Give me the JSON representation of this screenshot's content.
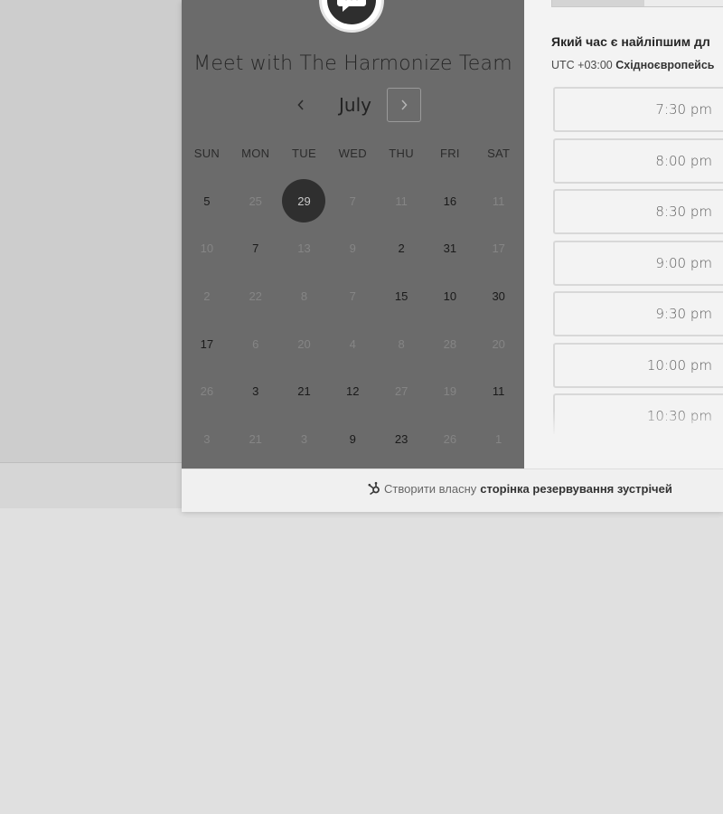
{
  "scheduler": {
    "title": "Meet with The Harmonize Team",
    "month": "July",
    "weekdays": [
      "SUN",
      "MON",
      "TUE",
      "WED",
      "THU",
      "FRI",
      "SAT"
    ],
    "weeks": [
      [
        {
          "d": "5",
          "s": "avail"
        },
        {
          "d": "25",
          "s": "dim"
        },
        {
          "d": "29",
          "s": "sel"
        },
        {
          "d": "7",
          "s": "dim"
        },
        {
          "d": "11",
          "s": "dim"
        },
        {
          "d": "16",
          "s": "avail"
        },
        {
          "d": "11",
          "s": "dim"
        }
      ],
      [
        {
          "d": "10",
          "s": "dim"
        },
        {
          "d": "7",
          "s": "avail"
        },
        {
          "d": "13",
          "s": "dim"
        },
        {
          "d": "9",
          "s": "dim"
        },
        {
          "d": "2",
          "s": "avail"
        },
        {
          "d": "31",
          "s": "avail"
        },
        {
          "d": "17",
          "s": "dim"
        }
      ],
      [
        {
          "d": "2",
          "s": "dim"
        },
        {
          "d": "22",
          "s": "dim"
        },
        {
          "d": "8",
          "s": "dim"
        },
        {
          "d": "7",
          "s": "dim"
        },
        {
          "d": "15",
          "s": "avail"
        },
        {
          "d": "10",
          "s": "avail"
        },
        {
          "d": "30",
          "s": "avail"
        }
      ],
      [
        {
          "d": "17",
          "s": "avail"
        },
        {
          "d": "6",
          "s": "dim"
        },
        {
          "d": "20",
          "s": "dim"
        },
        {
          "d": "4",
          "s": "dim"
        },
        {
          "d": "8",
          "s": "dim"
        },
        {
          "d": "28",
          "s": "dim"
        },
        {
          "d": "20",
          "s": "dim"
        }
      ],
      [
        {
          "d": "26",
          "s": "dim"
        },
        {
          "d": "3",
          "s": "avail"
        },
        {
          "d": "21",
          "s": "avail"
        },
        {
          "d": "12",
          "s": "avail"
        },
        {
          "d": "27",
          "s": "dim"
        },
        {
          "d": "19",
          "s": "dim"
        },
        {
          "d": "11",
          "s": "avail"
        }
      ],
      [
        {
          "d": "3",
          "s": "dim"
        },
        {
          "d": "21",
          "s": "dim"
        },
        {
          "d": "3",
          "s": "dim"
        },
        {
          "d": "9",
          "s": "avail"
        },
        {
          "d": "23",
          "s": "avail"
        },
        {
          "d": "26",
          "s": "dim"
        },
        {
          "d": "1",
          "s": "dim"
        }
      ]
    ]
  },
  "times": {
    "question": "Який час є найліпшим дл",
    "tz_prefix": "UTC +03:00",
    "tz_name": "Східноєвропейсь",
    "slots": [
      "7:30 pm",
      "8:00 pm",
      "8:30 pm",
      "9:00 pm",
      "9:30 pm",
      "10:00 pm",
      "10:30 pm"
    ]
  },
  "footer": {
    "prefix": "Створити власну",
    "link": "сторінка резервування зустрічей"
  },
  "icons": {
    "avatar": "chat-bubble-icon",
    "prev": "chevron-left-icon",
    "next": "chevron-right-icon",
    "footer": "hubspot-sprocket-icon"
  }
}
